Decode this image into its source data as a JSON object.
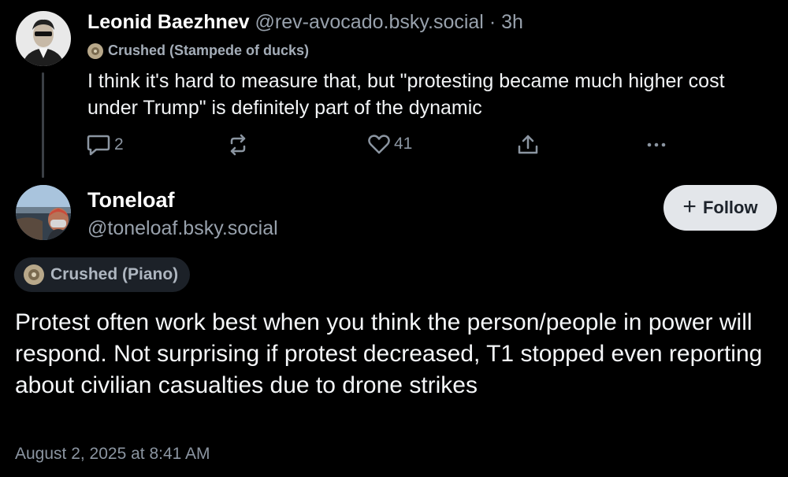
{
  "reply_post": {
    "author_name": "Leonid Baezhnev",
    "author_handle": "@rev-avocado.bsky.social",
    "separator": "·",
    "time": "3h",
    "badge": "Crushed (Stampede of ducks)",
    "text": "I think it's hard to measure that, but \"protesting became much higher cost under Trump\" is definitely part of the dynamic",
    "reply_count": "2",
    "like_count": "41"
  },
  "main_post": {
    "author_name": "Toneloaf",
    "author_handle": "@toneloaf.bsky.social",
    "follow_label": "Follow",
    "follow_icon": "+",
    "badge": "Crushed (Piano)",
    "text": "Protest often work best when you think the person/people in power will respond. Not surprising if protest decreased, T1 stopped even reporting about civilian casualties due to drone strikes",
    "timestamp": "August 2, 2025 at 8:41 AM"
  },
  "colors": {
    "background": "#000000",
    "muted_text": "#98a1ac",
    "follow_button_bg": "#e3e6ea",
    "badge_pill_bg": "#1c2128"
  }
}
